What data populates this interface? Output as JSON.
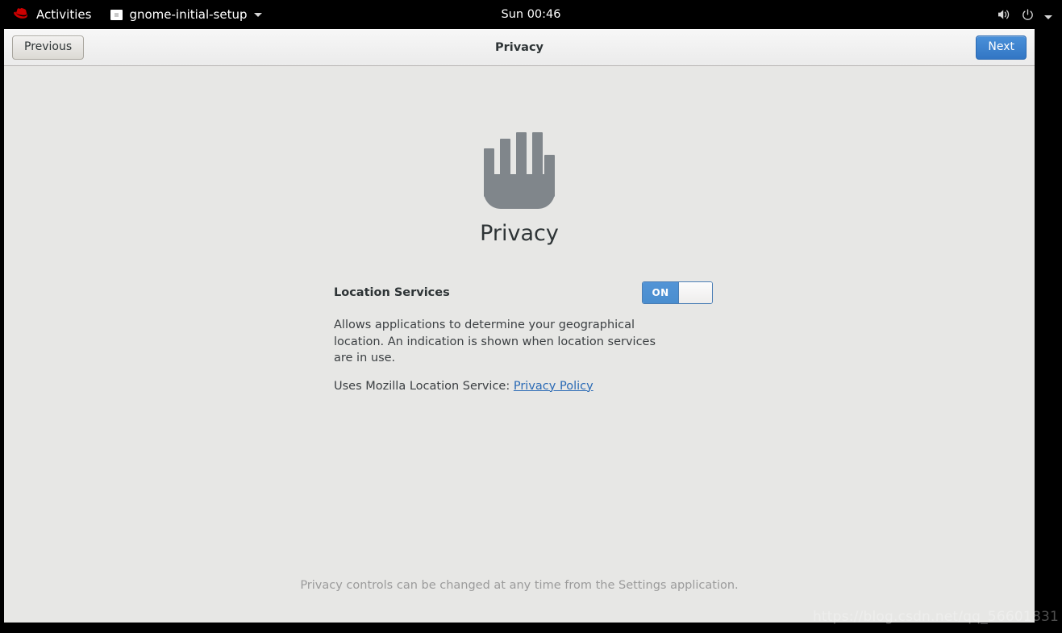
{
  "topbar": {
    "activities_label": "Activities",
    "app_name": "gnome-initial-setup",
    "clock": "Sun 00:46",
    "icons": {
      "distro": "redhat-logo-icon",
      "app": "window-icon",
      "menu_arrow": "chevron-down-icon",
      "volume": "volume-icon",
      "power": "power-icon",
      "system_menu_arrow": "chevron-down-icon"
    }
  },
  "window": {
    "headerbar": {
      "previous_label": "Previous",
      "title": "Privacy",
      "next_label": "Next"
    },
    "page": {
      "illustration": "hand-stop-icon",
      "heading": "Privacy",
      "setting": {
        "label": "Location Services",
        "toggle_state": "ON",
        "description": "Allows applications to determine your geographical location. An indication is shown when location services are in use.",
        "service_prefix": "Uses Mozilla Location Service:",
        "policy_link": "Privacy Policy"
      },
      "footer_note": "Privacy controls can be changed at any time from the Settings application."
    }
  },
  "watermark": "https://blog.csdn.net/qq_56601831",
  "colors": {
    "accent_blue": "#4a90d9",
    "toggle_blue": "#5294d6",
    "link_blue": "#2a6ab5",
    "window_bg": "#e7e7e5",
    "headerbar_bg": "#f2f1f0",
    "topbar_bg": "#000000",
    "hand_gray": "#80868b"
  }
}
